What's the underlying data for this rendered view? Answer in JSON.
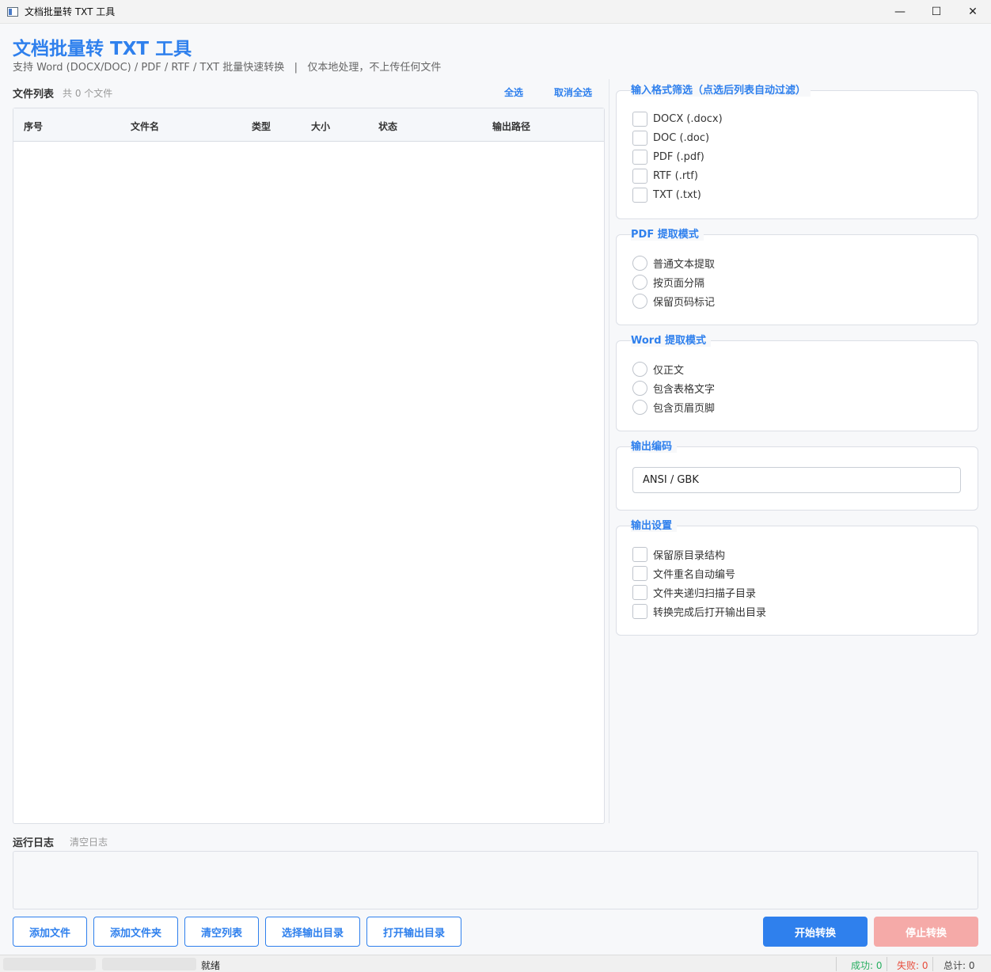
{
  "window": {
    "title": "文档批量转 TXT 工具",
    "minimize": "—",
    "maximize": "☐",
    "close": "✕"
  },
  "header": {
    "title": "文档批量转 TXT 工具",
    "subtitle": "支持 Word (DOCX/DOC) / PDF / RTF / TXT 批量快速转换   |   仅本地处理，不上传任何文件"
  },
  "file_list": {
    "label": "文件列表",
    "count": "共 0 个文件",
    "select_all": "全选",
    "deselect_all": "取消全选",
    "columns": [
      "序号",
      "文件名",
      "类型",
      "大小",
      "状态",
      "输出路径"
    ],
    "rows": []
  },
  "format_filter": {
    "title": "输入格式筛选（点选后列表自动过滤）",
    "options": [
      {
        "label": "DOCX (.docx)",
        "checked": false
      },
      {
        "label": "DOC (.doc)",
        "checked": false
      },
      {
        "label": "PDF (.pdf)",
        "checked": false
      },
      {
        "label": "RTF (.rtf)",
        "checked": false
      },
      {
        "label": "TXT (.txt)",
        "checked": false
      }
    ]
  },
  "pdf_mode": {
    "title": "PDF 提取模式",
    "options": [
      "普通文本提取",
      "按页面分隔",
      "保留页码标记"
    ]
  },
  "word_mode": {
    "title": "Word 提取模式",
    "options": [
      "仅正文",
      "包含表格文字",
      "包含页眉页脚"
    ]
  },
  "encoding": {
    "title": "输出编码",
    "value": "ANSI / GBK"
  },
  "output_settings": {
    "title": "输出设置",
    "options": [
      {
        "label": "保留原目录结构",
        "checked": false
      },
      {
        "label": "文件重名自动编号",
        "checked": false
      },
      {
        "label": "文件夹递归扫描子目录",
        "checked": false
      },
      {
        "label": "转换完成后打开输出目录",
        "checked": false
      }
    ]
  },
  "log": {
    "label": "运行日志",
    "clear": "清空日志",
    "content": ""
  },
  "buttons": {
    "add_file": "添加文件",
    "add_folder": "添加文件夹",
    "clear_list": "清空列表",
    "choose_output": "选择输出目录",
    "open_output": "打开输出目录",
    "start": "开始转换",
    "stop": "停止转换"
  },
  "status": {
    "state": "就绪",
    "success": "成功: 0",
    "failed": "失败: 0",
    "total": "总计: 0"
  },
  "colors": {
    "accent": "#2f80ed",
    "danger_disabled": "#f5aaa8",
    "success": "#27ae60",
    "error": "#e74c3c"
  }
}
